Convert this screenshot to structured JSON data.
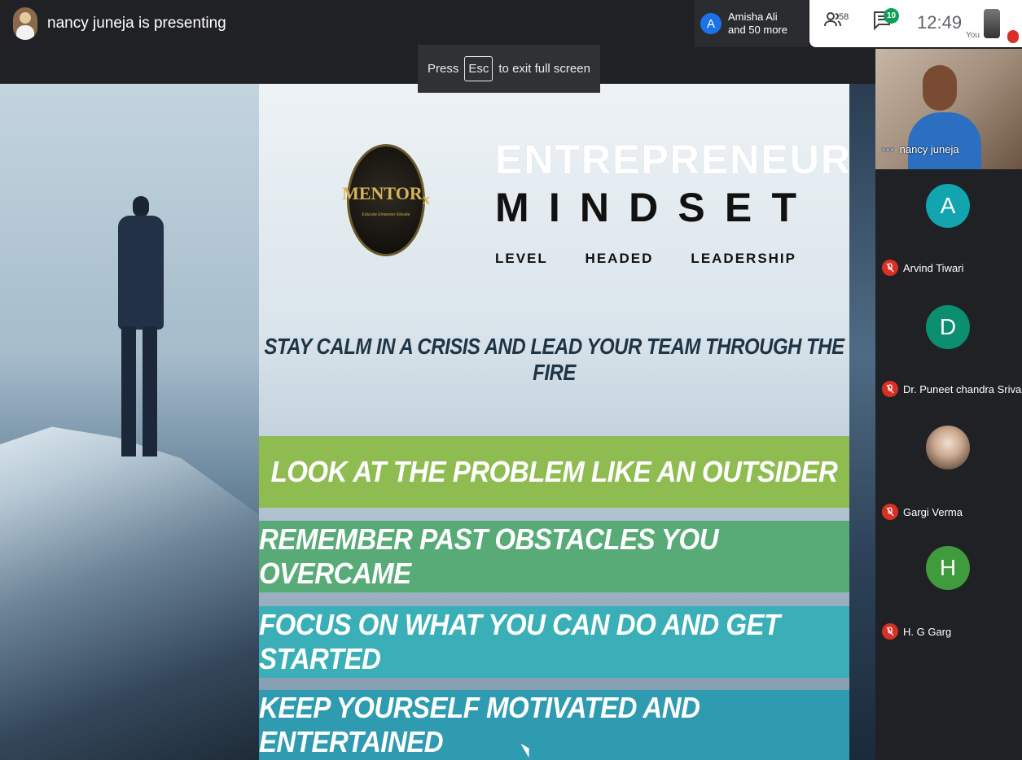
{
  "topbar": {
    "presenting_text": "nancy juneja is presenting",
    "joiners": {
      "initial": "A",
      "line1": "Amisha Ali",
      "line2": "and 50 more"
    },
    "people_count": "58",
    "chat_badge": "10",
    "time": "12:49",
    "you_label": "You"
  },
  "toast": {
    "prefix": "Press",
    "key": "Esc",
    "suffix": "to exit full screen"
  },
  "slide": {
    "logo_text": "MENTOR",
    "logo_sub": "x",
    "logo_tagline": "Educate Empower Elevate",
    "title_line1": "ENTREPRENEUR",
    "title_line2": "M I N D S E T",
    "title_line3": "LEVEL HEADED LEADERSHIP",
    "headline": "STAY CALM IN A CRISIS AND LEAD YOUR TEAM THROUGH THE FIRE",
    "points": [
      "LOOK AT THE PROBLEM LIKE AN OUTSIDER",
      "REMEMBER PAST OBSTACLES YOU OVERCAME",
      "FOCUS ON WHAT YOU CAN DO AND GET STARTED",
      "KEEP YOURSELF MOTIVATED AND ENTERTAINED"
    ],
    "colors": {
      "band1": "#8fbc51",
      "band2": "#58ab77",
      "band3": "#3bafb8",
      "band4": "#2f9bb0"
    }
  },
  "participants": {
    "self_tile": {
      "name": "nancy juneja"
    },
    "list": [
      {
        "initial": "A",
        "name": "Arvind Tiwari",
        "color": "#12a4af"
      },
      {
        "initial": "D",
        "name": "Dr. Puneet chandra Srivast...",
        "color": "#0b8f70"
      },
      {
        "initial": "",
        "name": "Gargi Verma",
        "color": "#c9a88e"
      },
      {
        "initial": "H",
        "name": "H. G Garg",
        "color": "#3f9b3b"
      }
    ]
  }
}
